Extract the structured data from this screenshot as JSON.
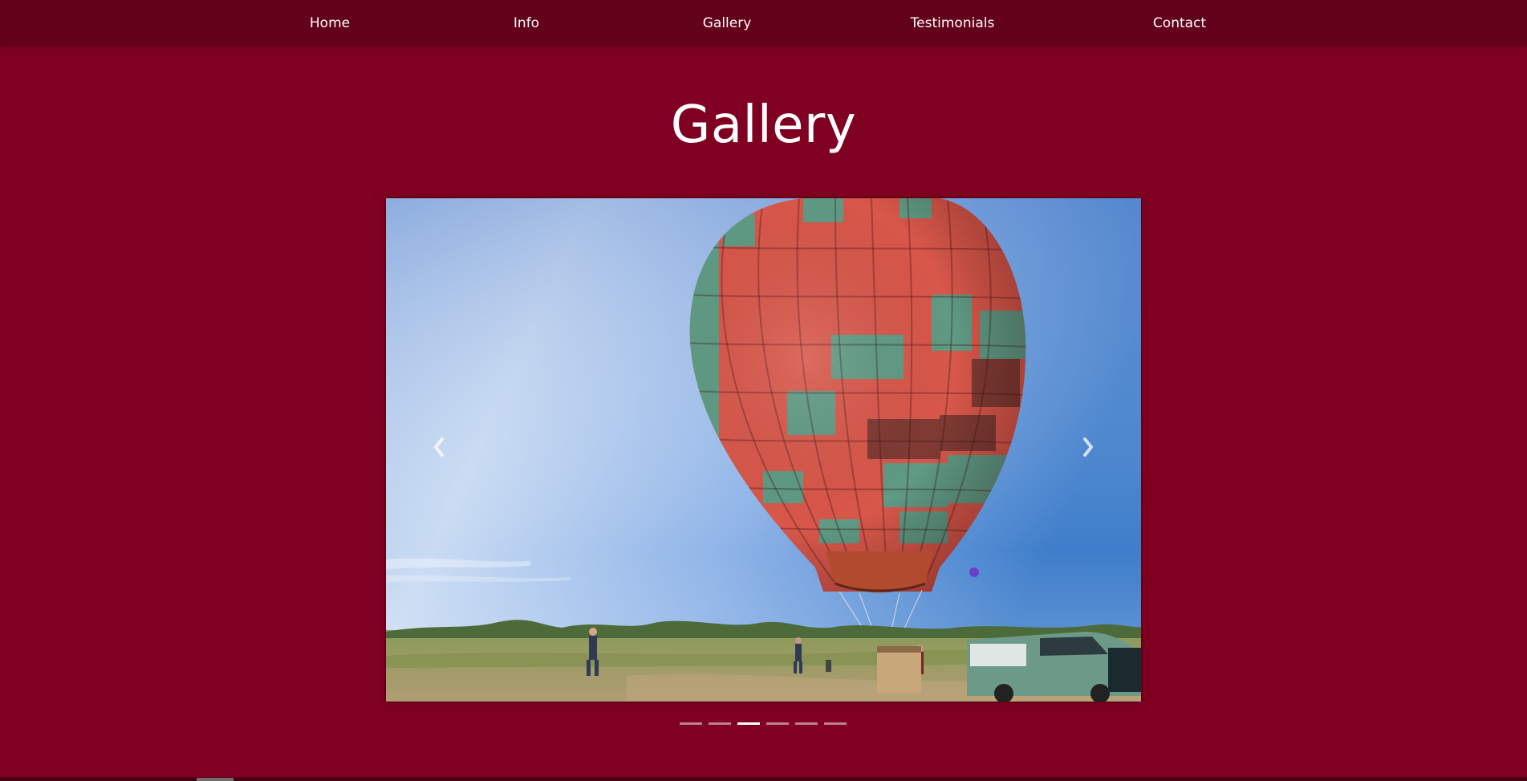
{
  "nav": {
    "items": [
      {
        "label": "Home"
      },
      {
        "label": "Info"
      },
      {
        "label": "Gallery"
      },
      {
        "label": "Testimonials"
      },
      {
        "label": "Contact"
      }
    ]
  },
  "page": {
    "title": "Gallery"
  },
  "carousel": {
    "prev_icon": "chevron-left-icon",
    "next_icon": "chevron-right-icon",
    "slide_count": 6,
    "active_slide": 3
  },
  "colors": {
    "background": "#7f0020",
    "navbar": "#63001a",
    "text": "#ffffff"
  }
}
